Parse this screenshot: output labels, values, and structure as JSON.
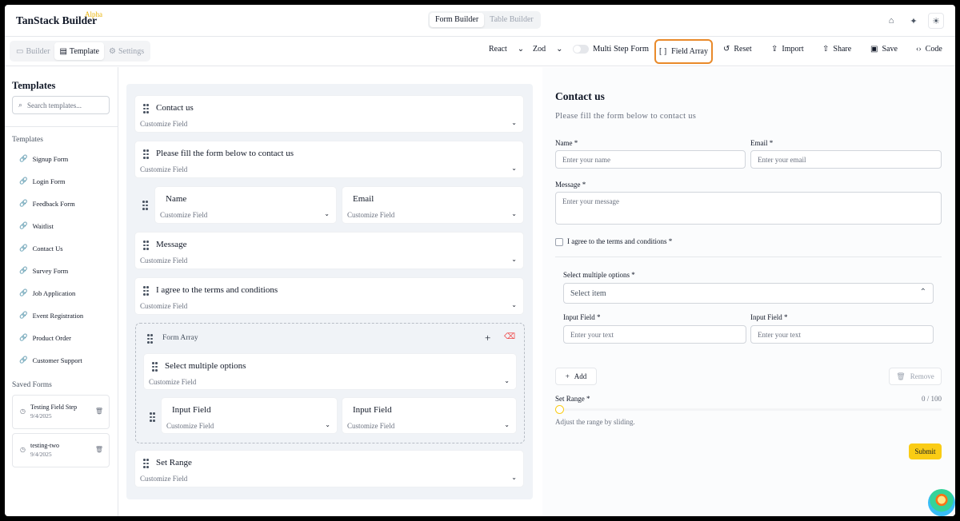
{
  "brand": {
    "name": "TanStack Builder",
    "badge": "Alpha"
  },
  "top_tabs": [
    "Form Builder",
    "Table Builder"
  ],
  "top_icons": [
    "github-icon",
    "twitter-icon",
    "sun-icon"
  ],
  "mode_tabs": [
    {
      "label": "Builder",
      "icon": "monitor-icon"
    },
    {
      "label": "Template",
      "icon": "document-icon"
    },
    {
      "label": "Settings",
      "icon": "gear-icon"
    }
  ],
  "toolbar": {
    "framework": "React",
    "validator": "Zod",
    "multi_step": "Multi Step Form",
    "field_array": "Field Array",
    "reset": "Reset",
    "import": "Import",
    "share": "Share",
    "save": "Save",
    "code": "Code"
  },
  "sidebar": {
    "title": "Templates",
    "search_placeholder": "Search templates...",
    "section": "Templates",
    "items": [
      "Signup Form",
      "Login Form",
      "Feedback Form",
      "Waitlist",
      "Contact Us",
      "Survey Form",
      "Job Application",
      "Event Registration",
      "Product Order",
      "Customer Support"
    ],
    "saved_title": "Saved Forms",
    "saved": [
      {
        "name": "Testing Field Step",
        "date": "9/4/2025"
      },
      {
        "name": "testing-two",
        "date": "9/4/2025"
      }
    ]
  },
  "editor": {
    "customize": "Customize Field",
    "fields": [
      "Contact us",
      "Please fill the form below to contact us",
      "Name",
      "Email",
      "Message",
      "I agree to the terms and conditions",
      "Select multiple options",
      "Input Field",
      "Input Field",
      "Set Range"
    ],
    "form_array": "Form Array"
  },
  "preview": {
    "title": "Contact us",
    "subtitle": "Please fill the form below to contact us",
    "name_label": "Name *",
    "name_ph": "Enter your name",
    "email_label": "Email *",
    "email_ph": "Enter your email",
    "message_label": "Message *",
    "message_ph": "Enter your message",
    "agree": "I agree to the terms and conditions *",
    "select_label": "Select multiple options *",
    "select_ph": "Select item",
    "input1_label": "Input Field *",
    "input1_ph": "Enter your text",
    "input2_label": "Input Field *",
    "input2_ph": "Enter your text",
    "add": "Add",
    "remove": "Remove",
    "range_label": "Set Range *",
    "range_value": "0 / 100",
    "range_help": "Adjust the range by sliding.",
    "submit": "Submit",
    "accent": "#facc15"
  }
}
